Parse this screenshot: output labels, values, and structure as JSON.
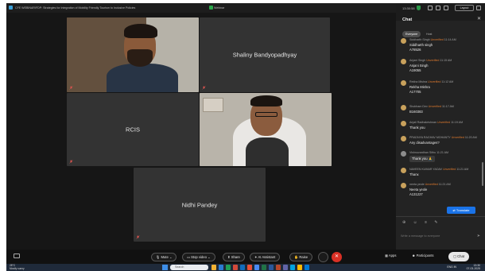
{
  "titlebar": {
    "meeting_title": "CFE WEBINAR/FDP: Strategies for Integration of Mobility Friendly Tourism to Inclusive Policies",
    "status": "Webinar tools",
    "meeting_label": "Webinar"
  },
  "clock": "13:30:58",
  "layout_label": "Layout",
  "participants": [
    {
      "name": "",
      "video": true
    },
    {
      "name": "Shaliny Bandyopadhyay",
      "video": false
    },
    {
      "name": "RCIS",
      "video": false
    },
    {
      "name": "",
      "video": true
    },
    {
      "name": "Nidhi Pandey",
      "video": false
    }
  ],
  "chat": {
    "title": "Chat",
    "close_icon": "close-icon",
    "tabs": [
      "Everyone",
      "Host"
    ],
    "messages": [
      {
        "sender": "Siddharth Singh",
        "tag": "Unverified",
        "time": "11:14 AM",
        "lines": [
          "Siddharth singh",
          "A78526"
        ]
      },
      {
        "sender": "Anjani Singh",
        "tag": "Unverified",
        "time": "11:15 AM",
        "lines": [
          "Anjani Singh",
          "A19055"
        ]
      },
      {
        "sender": "Rekha Mishra",
        "tag": "Unverified",
        "time": "11:12 AM",
        "lines": [
          "Rekha Mishra",
          "A17705"
        ]
      },
      {
        "sender": "Shubham Dev",
        "tag": "Unverified",
        "time": "11:17 AM",
        "lines": [
          "B160383"
        ]
      },
      {
        "sender": "Anjali Radhakrishnan",
        "tag": "Unverified",
        "time": "11:19 AM",
        "lines": [
          "Thank you"
        ]
      },
      {
        "sender": "PRADNYA RAGHAV MOHANTY",
        "tag": "Unverified",
        "time": "11:20 AM",
        "lines": [
          "Any disadvantages?"
        ]
      },
      {
        "sender": "Vishnuvardhan Sithu",
        "tag": "",
        "time": "11:21 AM",
        "lines": [
          "Thank you 🙏"
        ]
      },
      {
        "sender": "NAVEEN KUMAR YADAV",
        "tag": "Unverified",
        "time": "11:21 AM",
        "lines": [
          "Thanx"
        ]
      },
      {
        "sender": "neeta yeole",
        "tag": "Unverified",
        "time": "11:21 AM",
        "lines": [
          "Neeta yeole",
          "A131227"
        ]
      }
    ],
    "translate_label": "Translate",
    "input_placeholder": "Write a message to everyone"
  },
  "toolbar": {
    "mute": "Mute",
    "stop_video": "Stop video",
    "share": "Share",
    "ai_assistant": "AI Assistant",
    "raise": "Raise",
    "apps": "Apps",
    "participants": "Participants",
    "chat": "Chat"
  },
  "taskbar": {
    "weather_temp": "28°C",
    "weather_desc": "Mostly sunny",
    "search_placeholder": "Search",
    "lang": "ENG IN",
    "time": "13:30",
    "date": "07-03-2025"
  },
  "colors": {
    "accent": "#1a73e8",
    "leave": "#d93025",
    "unverified": "#e07a2e",
    "tile_bg": "#333333",
    "app_bg": "#161616"
  }
}
